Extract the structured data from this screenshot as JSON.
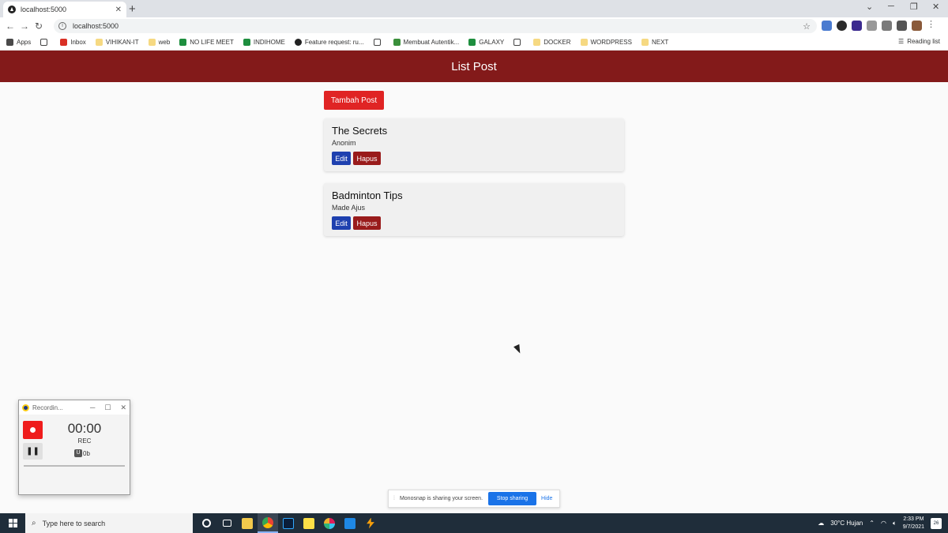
{
  "browser": {
    "tab_title": "localhost:5000",
    "url": "localhost:5000",
    "bookmarks": [
      "Apps",
      "",
      "Inbox",
      "VIHIKAN-IT",
      "web",
      "NO LIFE MEET",
      "INDIHOME",
      "Feature request: ru...",
      "",
      "Membuat Autentik...",
      "GALAXY",
      "",
      "DOCKER",
      "WORDPRESS",
      "NEXT"
    ],
    "reading_list": "Reading list"
  },
  "app": {
    "title": "List Post",
    "add_button": "Tambah Post",
    "edit_label": "Edit",
    "delete_label": "Hapus",
    "posts": [
      {
        "title": "The Secrets",
        "author": "Anonim"
      },
      {
        "title": "Badminton Tips",
        "author": "Made Ajus"
      }
    ]
  },
  "recorder": {
    "title": "Recordin...",
    "time": "00:00",
    "status": "REC",
    "size": "0b",
    "size_icon": "U"
  },
  "sharebar": {
    "message": "Monosnap is sharing your screen.",
    "stop_label": "Stop sharing",
    "hide_label": "Hide"
  },
  "taskbar": {
    "search_placeholder": "Type here to search",
    "weather": "30°C  Hujan",
    "time": "2:33 PM",
    "date": "9/7/2021",
    "notifications": "26"
  }
}
